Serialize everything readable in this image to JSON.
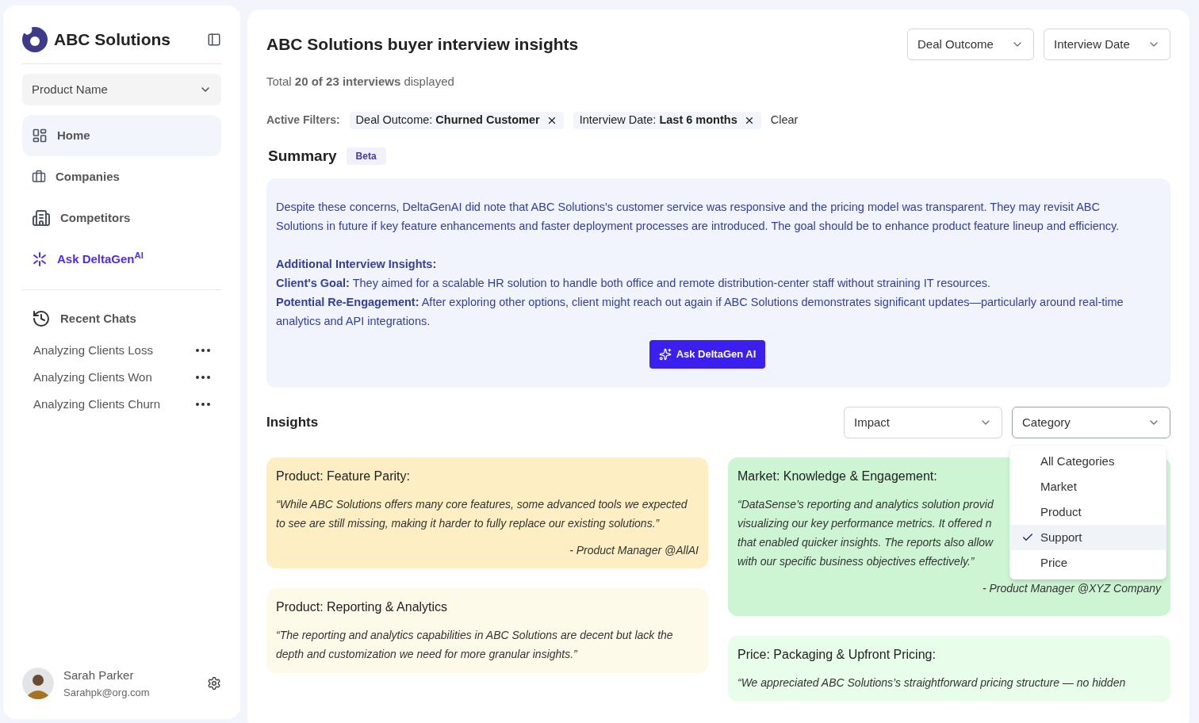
{
  "sidebar": {
    "brand": "ABC Solutions",
    "product_select": {
      "value": "Product Name"
    },
    "nav": [
      {
        "label": "Home",
        "kind": "home",
        "selected": true
      },
      {
        "label": "Companies",
        "kind": "companies",
        "selected": false
      },
      {
        "label": "Competitors",
        "kind": "competitors",
        "selected": false
      },
      {
        "label": "Ask DeltaGen$^{AI}$",
        "kind": "ai",
        "selected": false
      }
    ],
    "recent_chats": {
      "title": "Recent Chats",
      "items": [
        {
          "label": "Analyzing Clients Loss"
        },
        {
          "label": "Analyzing Clients Won"
        },
        {
          "label": "Analyzing Clients Churn"
        }
      ]
    },
    "user": {
      "name": "Sarah Parker",
      "email": "Sarahpk@org.com"
    }
  },
  "header": {
    "title": "ABC Solutions buyer interview insights",
    "filters": [
      {
        "label": "Deal Outcome"
      },
      {
        "label": "Interview Date"
      }
    ]
  },
  "total": "Total **20 of 23 interviews** displayed",
  "active_filters": {
    "label": "Active Filters:",
    "chips": [
      {
        "text": "Deal Outcome: **Churned Customer**"
      },
      {
        "text": "Interview Date: **Last 6 months**"
      }
    ],
    "clear": "Clear"
  },
  "summary": {
    "title": "Summary",
    "badge": "Beta",
    "paragraphs": [
      "Despite these concerns, DeltaGenAI did note that ABC Solutions's customer service was responsive and the pricing model was transparent. They may revisit ABC Solutions in future if key feature enhancements and faster deployment processes are introduced. The goal should be to enhance product feature lineup and efficiency."
    ],
    "insights_heading": "Additional Interview Insights:",
    "insights": [
      "**Client's Goal:** They aimed for a scalable HR solution to handle both office and remote distribution-center staff without straining IT resources.",
      "**Potential Re-Engagement:** After exploring other options, client might reach out again if ABC Solutions demonstrates significant updates—particularly around real-time analytics and API integrations."
    ],
    "button": "Ask DeltaGen AI"
  },
  "insights": {
    "title": "Insights",
    "filters": [
      {
        "label": "Impact",
        "expanded": false
      },
      {
        "label": "Category",
        "expanded": true,
        "options": [
          {
            "label": "All Categories",
            "selected": false
          },
          {
            "label": "Market",
            "selected": false
          },
          {
            "label": "Product",
            "selected": false
          },
          {
            "label": "Support",
            "selected": true
          },
          {
            "label": "Price",
            "selected": false
          }
        ]
      }
    ],
    "columns": [
      {
        "cards": [
          {
            "title": "Product: Feature Parity:",
            "color": "#fdefc3",
            "quote": [
              "“While ABC Solutions offers many core features, some advanced tools we expected to see are still missing, making it harder to fully replace our existing solutions.”"
            ],
            "author": "- Product Manager @AllAI"
          },
          {
            "title": "Product: Reporting & Analytics",
            "color": "#fefaea",
            "quote": [
              "“The reporting and analytics capabilities in ABC Solutions are decent but lack the depth and customization we need for more granular insights.”"
            ]
          }
        ]
      },
      {
        "cards": [
          {
            "title": "Market: Knowledge & Engagement:",
            "color": "#cdf5d3",
            "quote": [
              "“DataSense’s reporting and analytics solution provid",
              "visualizing our key performance metrics. It offered n",
              "that enabled quicker insights. The reports also allow",
              "with our specific business objectives effectively.”"
            ],
            "author": "- Product Manager @XYZ Company"
          },
          {
            "title": "Price: Packaging & Upfront Pricing:",
            "color": "#e9fdeb",
            "quote": [
              "“We appreciated ABC Solutions’s straightforward pricing structure — no hidden"
            ]
          }
        ]
      }
    ]
  }
}
